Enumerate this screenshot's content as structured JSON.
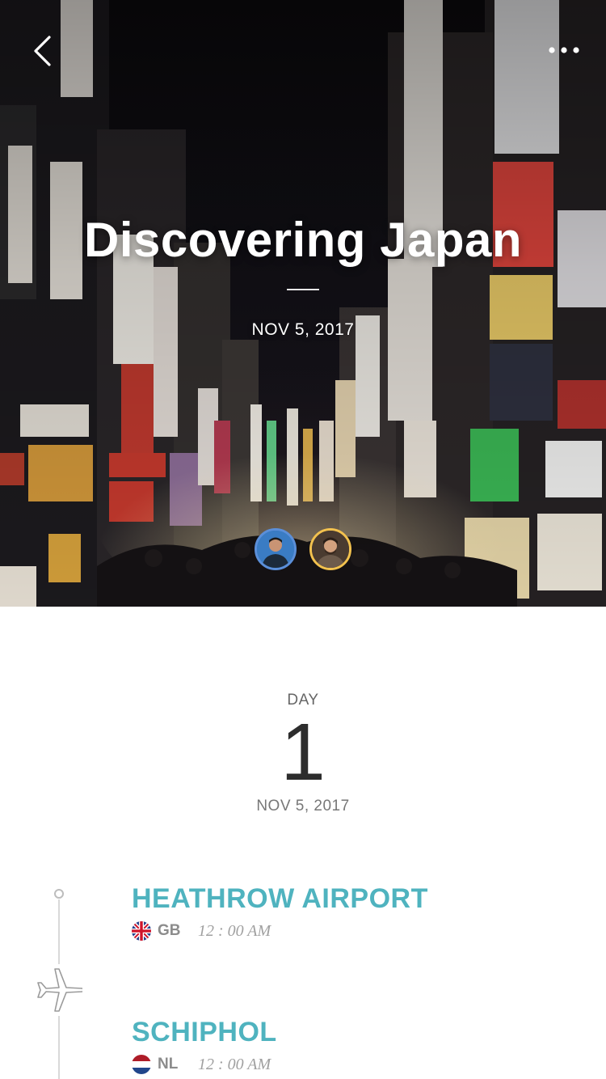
{
  "hero": {
    "title": "Discovering Japan",
    "date": "NOV 5, 2017",
    "back_icon": "chevron-left-icon",
    "more_icon": "more-dots-icon",
    "avatars": [
      {
        "name": "traveler-avatar-1",
        "ring_color": "#5b8fd9"
      },
      {
        "name": "traveler-avatar-2",
        "ring_color": "#f2c14e"
      }
    ]
  },
  "day": {
    "label": "DAY",
    "number": "1",
    "date": "NOV 5, 2017"
  },
  "timeline": {
    "transport_icon": "airplane-icon",
    "stops": [
      {
        "name": "HEATHROW AIRPORT",
        "country": "GB",
        "time": "12 : 00 AM",
        "flag_icon": "flag-gb-icon"
      },
      {
        "name": "SCHIPHOL",
        "country": "NL",
        "time": "12 : 00 AM",
        "flag_icon": "flag-nl-icon"
      }
    ]
  },
  "colors": {
    "accent": "#4fb3bf",
    "heading_dark": "#2d2d2d",
    "muted": "#8c8c8c"
  }
}
